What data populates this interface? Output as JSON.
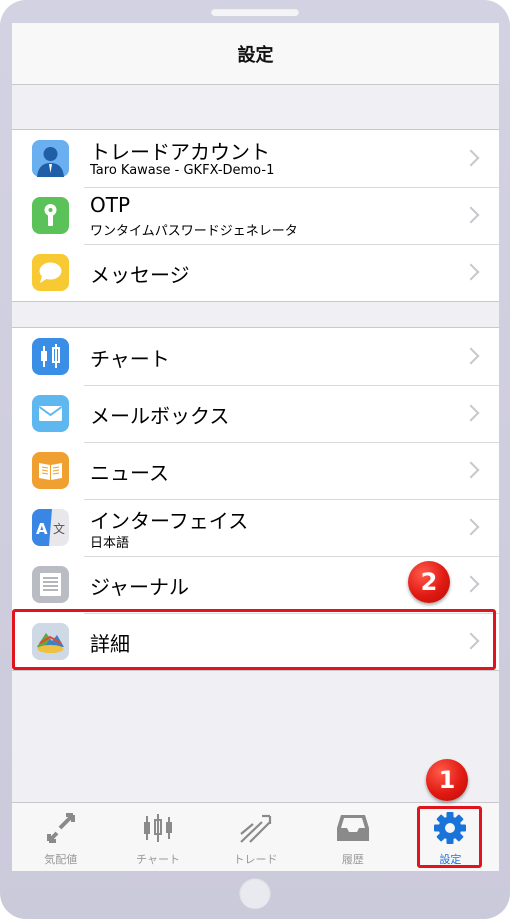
{
  "header": {
    "title": "設定"
  },
  "group1": [
    {
      "label": "トレードアカウント",
      "sub": "Taro Kawase - GKFX-Demo-1",
      "icon": "account-person-icon"
    },
    {
      "label": "OTP",
      "sub": "ワンタイムパスワードジェネレータ",
      "icon": "otp-key-icon"
    },
    {
      "label": "メッセージ",
      "sub": "",
      "icon": "message-bubble-icon"
    }
  ],
  "group2": [
    {
      "label": "チャート",
      "sub": "",
      "icon": "chart-candles-icon"
    },
    {
      "label": "メールボックス",
      "sub": "",
      "icon": "mail-envelope-icon"
    },
    {
      "label": "ニュース",
      "sub": "",
      "icon": "news-book-icon"
    },
    {
      "label": "インターフェイス",
      "sub": "日本語",
      "icon": "interface-translate-icon"
    },
    {
      "label": "ジャーナル",
      "sub": "",
      "icon": "journal-lines-icon"
    },
    {
      "label": "詳細",
      "sub": "",
      "icon": "details-metatrader-icon"
    }
  ],
  "tabbar": [
    {
      "label": "気配値",
      "icon": "quotes-arrows-icon",
      "active": false
    },
    {
      "label": "チャート",
      "icon": "chart-candles-icon",
      "active": false
    },
    {
      "label": "トレード",
      "icon": "trade-arrows-icon",
      "active": false
    },
    {
      "label": "履歴",
      "icon": "history-inbox-icon",
      "active": false
    },
    {
      "label": "設定",
      "icon": "settings-gear-icon",
      "active": true
    }
  ],
  "annotations": {
    "badge1": "1",
    "badge2": "2"
  },
  "colors": {
    "accent": "#1a73d9",
    "highlight": "#e0141c",
    "background": "#efeff4"
  }
}
